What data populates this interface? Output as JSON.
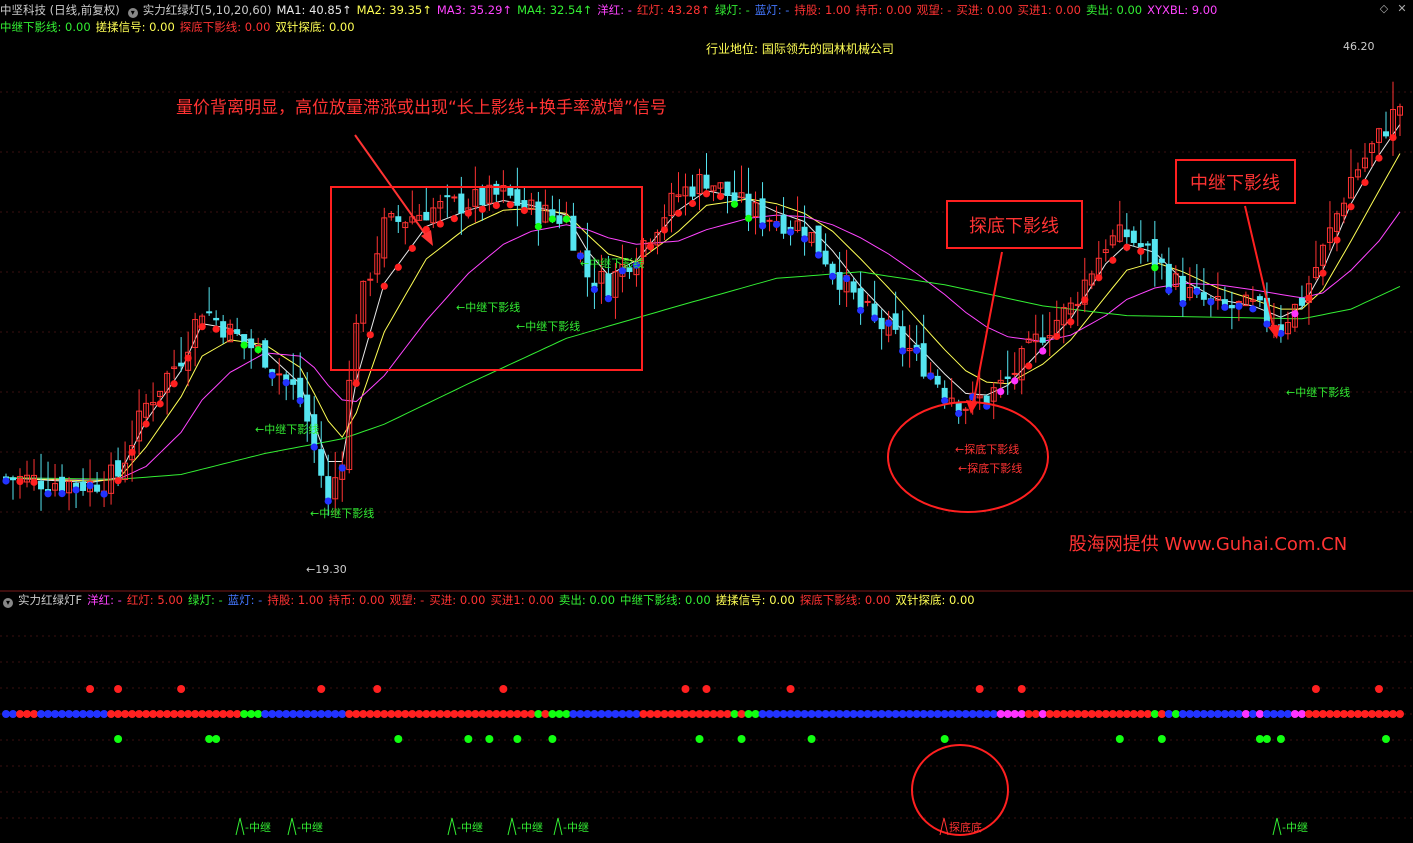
{
  "header": {
    "stock": "中坚科技 (日线,前复权)",
    "indicator": "实力红绿灯(5,10,20,60)",
    "row1": [
      {
        "text": "MA1: 40.85↑",
        "color": "#e8e8e8"
      },
      {
        "text": "MA2: 39.35↑",
        "color": "#ffff55"
      },
      {
        "text": "MA3: 35.29↑",
        "color": "#ff44ff"
      },
      {
        "text": "MA4: 32.54↑",
        "color": "#33ee33"
      },
      {
        "text": "洋红: -",
        "color": "#ff44ff"
      },
      {
        "text": "红灯: 43.28↑",
        "color": "#ff3333"
      },
      {
        "text": "绿灯: -",
        "color": "#33ee33"
      },
      {
        "text": "蓝灯: -",
        "color": "#4477ff"
      },
      {
        "text": "持股: 1.00",
        "color": "#ff3333"
      },
      {
        "text": "持币: 0.00",
        "color": "#ff3333"
      },
      {
        "text": "观望: -",
        "color": "#ff3333"
      },
      {
        "text": "买进: 0.00",
        "color": "#ff3333"
      },
      {
        "text": "买进1: 0.00",
        "color": "#ff3333"
      },
      {
        "text": "卖出: 0.00",
        "color": "#33ee33"
      },
      {
        "text": "XYXBL: 9.00",
        "color": "#ff44ff"
      }
    ],
    "row2": [
      {
        "text": "中继下影线: 0.00",
        "color": "#33ee33"
      },
      {
        "text": "搓揉信号: 0.00",
        "color": "#ffff55"
      },
      {
        "text": "探底下影线: 0.00",
        "color": "#ff3333"
      },
      {
        "text": "双针探底: 0.00",
        "color": "#ffff55"
      }
    ]
  },
  "industry": "行业地位: 国际领先的园林机械公司",
  "annotations": {
    "main_note": "量价背离明显，高位放量滞涨或出现“长上影线+换手率激增”信号",
    "box_bottom": "探底下影线",
    "box_relay": "中继下影线",
    "watermark": "股海网提供 Www.Guhai.Com.CN",
    "high_label": "46.20",
    "low_label": "19.30",
    "relay_tag": "中继下影线",
    "bottom_tag": "探底下影线"
  },
  "sub_panel": {
    "indicator": "实力红绿灯F",
    "values": [
      {
        "text": "洋红: -",
        "color": "#ff44ff"
      },
      {
        "text": "红灯: 5.00",
        "color": "#ff3333"
      },
      {
        "text": "绿灯: -",
        "color": "#33ee33"
      },
      {
        "text": "蓝灯: -",
        "color": "#4477ff"
      },
      {
        "text": "持股: 1.00",
        "color": "#ff3333"
      },
      {
        "text": "持币: 0.00",
        "color": "#ff3333"
      },
      {
        "text": "观望: -",
        "color": "#ff3333"
      },
      {
        "text": "买进: 0.00",
        "color": "#ff3333"
      },
      {
        "text": "买进1: 0.00",
        "color": "#ff3333"
      },
      {
        "text": "卖出: 0.00",
        "color": "#33ee33"
      },
      {
        "text": "中继下影线: 0.00",
        "color": "#33ee33"
      },
      {
        "text": "搓揉信号: 0.00",
        "color": "#ffff55"
      },
      {
        "text": "探底下影线: 0.00",
        "color": "#ff3333"
      },
      {
        "text": "双针探底: 0.00",
        "color": "#ffff55"
      }
    ],
    "relay_short": "中继",
    "bottom_short": "探底底"
  },
  "chart_data": {
    "type": "line",
    "title": "",
    "ylim": [
      17,
      50
    ],
    "x_count": 200,
    "price_points": [
      [
        0,
        23.0
      ],
      [
        12,
        22.6
      ],
      [
        16,
        23.2
      ],
      [
        20,
        27.5
      ],
      [
        25,
        30.5
      ],
      [
        28,
        33.5
      ],
      [
        32,
        32.0
      ],
      [
        37,
        30.5
      ],
      [
        42,
        28.0
      ],
      [
        44,
        25.0
      ],
      [
        46,
        21.5
      ],
      [
        48,
        24.5
      ],
      [
        50,
        33.0
      ],
      [
        54,
        38.5
      ],
      [
        60,
        39.5
      ],
      [
        66,
        40.0
      ],
      [
        71,
        40.5
      ],
      [
        75,
        39.5
      ],
      [
        80,
        39.0
      ],
      [
        83,
        35.5
      ],
      [
        86,
        35.0
      ],
      [
        90,
        37.0
      ],
      [
        96,
        40.5
      ],
      [
        100,
        41.5
      ],
      [
        106,
        39.5
      ],
      [
        110,
        39.0
      ],
      [
        114,
        38.5
      ],
      [
        118,
        36.0
      ],
      [
        122,
        33.5
      ],
      [
        126,
        32.0
      ],
      [
        130,
        30.5
      ],
      [
        134,
        28.5
      ],
      [
        137,
        27.5
      ],
      [
        140,
        28.0
      ],
      [
        143,
        29.0
      ],
      [
        148,
        32.0
      ],
      [
        152,
        33.5
      ],
      [
        157,
        37.5
      ],
      [
        160,
        38.0
      ],
      [
        164,
        36.5
      ],
      [
        168,
        34.5
      ],
      [
        173,
        33.5
      ],
      [
        178,
        33.5
      ],
      [
        182,
        32.5
      ],
      [
        185,
        34.0
      ],
      [
        188,
        37.0
      ],
      [
        192,
        41.5
      ],
      [
        196,
        44.0
      ],
      [
        199,
        46.0
      ]
    ],
    "ma5_points": [
      [
        0,
        23.0
      ],
      [
        12,
        22.7
      ],
      [
        16,
        23.0
      ],
      [
        20,
        26.5
      ],
      [
        25,
        29.6
      ],
      [
        28,
        32.5
      ],
      [
        32,
        32.2
      ],
      [
        37,
        30.8
      ],
      [
        42,
        28.8
      ],
      [
        44,
        26.3
      ],
      [
        46,
        24.0
      ],
      [
        48,
        24.0
      ],
      [
        50,
        29.0
      ],
      [
        54,
        35.0
      ],
      [
        60,
        38.5
      ],
      [
        66,
        39.5
      ],
      [
        71,
        40.1
      ],
      [
        75,
        39.8
      ],
      [
        80,
        39.2
      ],
      [
        83,
        37.0
      ],
      [
        86,
        35.5
      ],
      [
        90,
        36.4
      ],
      [
        96,
        39.5
      ],
      [
        100,
        40.7
      ],
      [
        106,
        40.2
      ],
      [
        110,
        39.4
      ],
      [
        114,
        38.8
      ],
      [
        118,
        37.0
      ],
      [
        122,
        34.8
      ],
      [
        126,
        33.0
      ],
      [
        130,
        31.2
      ],
      [
        134,
        29.4
      ],
      [
        137,
        28.2
      ],
      [
        140,
        28.1
      ],
      [
        143,
        28.7
      ],
      [
        148,
        31.0
      ],
      [
        152,
        32.8
      ],
      [
        157,
        36.2
      ],
      [
        160,
        37.4
      ],
      [
        164,
        36.9
      ],
      [
        168,
        35.2
      ],
      [
        173,
        34.0
      ],
      [
        178,
        33.6
      ],
      [
        182,
        32.9
      ],
      [
        185,
        33.5
      ],
      [
        188,
        35.8
      ],
      [
        192,
        39.9
      ],
      [
        196,
        42.9
      ],
      [
        199,
        44.8
      ]
    ],
    "ma10_points": [
      [
        0,
        23.0
      ],
      [
        12,
        22.8
      ],
      [
        16,
        22.9
      ],
      [
        20,
        24.9
      ],
      [
        25,
        28.0
      ],
      [
        28,
        30.5
      ],
      [
        32,
        31.5
      ],
      [
        37,
        31.2
      ],
      [
        42,
        29.8
      ],
      [
        44,
        28.2
      ],
      [
        46,
        26.5
      ],
      [
        48,
        25.5
      ],
      [
        50,
        27.0
      ],
      [
        54,
        32.0
      ],
      [
        60,
        36.5
      ],
      [
        66,
        38.5
      ],
      [
        71,
        39.5
      ],
      [
        75,
        39.6
      ],
      [
        80,
        39.3
      ],
      [
        83,
        38.0
      ],
      [
        86,
        36.8
      ],
      [
        90,
        36.3
      ],
      [
        96,
        38.2
      ],
      [
        100,
        39.8
      ],
      [
        106,
        40.2
      ],
      [
        110,
        39.9
      ],
      [
        114,
        39.3
      ],
      [
        118,
        38.2
      ],
      [
        122,
        36.5
      ],
      [
        126,
        34.7
      ],
      [
        130,
        32.8
      ],
      [
        134,
        30.9
      ],
      [
        137,
        29.6
      ],
      [
        140,
        28.9
      ],
      [
        143,
        28.8
      ],
      [
        148,
        30.0
      ],
      [
        152,
        31.5
      ],
      [
        157,
        34.2
      ],
      [
        160,
        35.8
      ],
      [
        164,
        36.3
      ],
      [
        168,
        35.7
      ],
      [
        173,
        34.7
      ],
      [
        178,
        34.0
      ],
      [
        182,
        33.4
      ],
      [
        185,
        33.4
      ],
      [
        188,
        34.6
      ],
      [
        192,
        37.6
      ],
      [
        196,
        40.7
      ],
      [
        199,
        43.0
      ]
    ],
    "ma20_points": [
      [
        0,
        23.0
      ],
      [
        12,
        22.9
      ],
      [
        16,
        22.9
      ],
      [
        20,
        23.7
      ],
      [
        25,
        25.8
      ],
      [
        28,
        27.8
      ],
      [
        32,
        29.5
      ],
      [
        37,
        30.7
      ],
      [
        42,
        30.5
      ],
      [
        44,
        29.8
      ],
      [
        46,
        28.7
      ],
      [
        48,
        27.8
      ],
      [
        50,
        27.7
      ],
      [
        54,
        29.3
      ],
      [
        60,
        32.7
      ],
      [
        66,
        35.6
      ],
      [
        71,
        37.4
      ],
      [
        75,
        38.2
      ],
      [
        80,
        38.6
      ],
      [
        83,
        38.3
      ],
      [
        86,
        37.8
      ],
      [
        90,
        37.4
      ],
      [
        96,
        37.6
      ],
      [
        100,
        38.3
      ],
      [
        106,
        39.0
      ],
      [
        110,
        39.2
      ],
      [
        114,
        39.1
      ],
      [
        118,
        38.6
      ],
      [
        122,
        37.8
      ],
      [
        126,
        36.8
      ],
      [
        130,
        35.6
      ],
      [
        134,
        34.3
      ],
      [
        137,
        33.2
      ],
      [
        140,
        32.3
      ],
      [
        143,
        31.7
      ],
      [
        148,
        31.4
      ],
      [
        152,
        31.8
      ],
      [
        157,
        33.0
      ],
      [
        160,
        34.0
      ],
      [
        164,
        34.7
      ],
      [
        168,
        35.0
      ],
      [
        173,
        34.9
      ],
      [
        178,
        34.6
      ],
      [
        182,
        34.3
      ],
      [
        185,
        34.1
      ],
      [
        188,
        34.4
      ],
      [
        192,
        35.8
      ],
      [
        196,
        37.6
      ],
      [
        199,
        39.4
      ]
    ],
    "ma60_points": [
      [
        0,
        23.0
      ],
      [
        16,
        22.9
      ],
      [
        25,
        23.2
      ],
      [
        37,
        24.5
      ],
      [
        48,
        25.4
      ],
      [
        54,
        26.3
      ],
      [
        66,
        28.8
      ],
      [
        80,
        31.6
      ],
      [
        96,
        33.6
      ],
      [
        110,
        35.3
      ],
      [
        122,
        35.7
      ],
      [
        134,
        34.9
      ],
      [
        148,
        33.6
      ],
      [
        160,
        33.0
      ],
      [
        173,
        32.9
      ],
      [
        185,
        32.8
      ],
      [
        192,
        33.4
      ],
      [
        199,
        34.8
      ]
    ],
    "top_red_dots": [
      12,
      16,
      25,
      45,
      53,
      71,
      97,
      100,
      112,
      139,
      145,
      187,
      196
    ],
    "bottom_green_dots": [
      16,
      29,
      30,
      56,
      66,
      69,
      73,
      78,
      99,
      105,
      115,
      134,
      159,
      165,
      179,
      180,
      182,
      197
    ]
  },
  "colors": {
    "up_candle": "#ff3333",
    "down_candle": "#55e5f0",
    "ma1": "#e8e8e8",
    "ma2": "#ffff55",
    "ma3": "#ff44ff",
    "ma4": "#33ee33",
    "red": "#ff2020",
    "green": "#11ff11",
    "blue": "#2233ff",
    "magenta": "#ff33ff"
  }
}
